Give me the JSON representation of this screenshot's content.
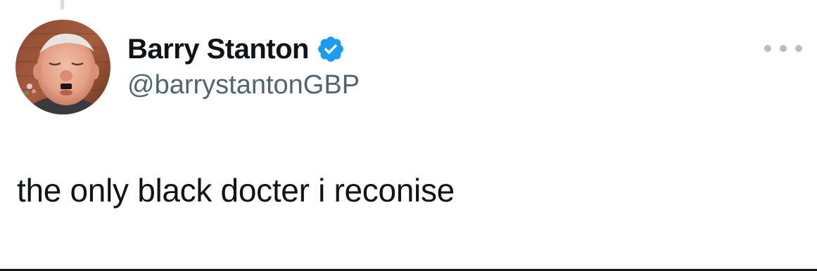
{
  "tweet": {
    "author": {
      "display_name": "Barry Stanton",
      "handle": "@barrystantonGBP",
      "verified": true,
      "avatar_icon": "profile-photo"
    },
    "text": "the only black docter i reconise",
    "more_icon": "more-options-icon"
  },
  "colors": {
    "text_primary": "#0f1419",
    "text_secondary": "#536471",
    "verified_blue": "#1d9bf0",
    "more_dots": "#b5bdc5"
  }
}
